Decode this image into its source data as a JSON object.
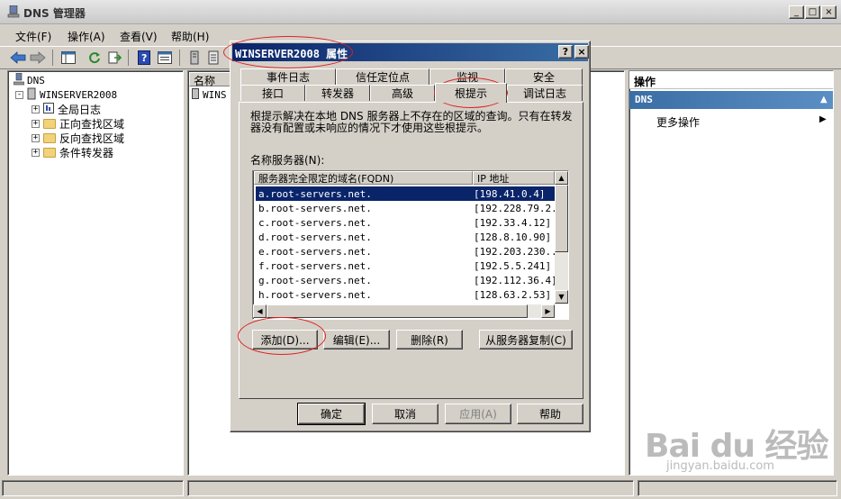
{
  "app": {
    "title": "DNS 管理器",
    "window_controls": [
      "_",
      "□",
      "×"
    ]
  },
  "menu": [
    "文件(F)",
    "操作(A)",
    "查看(V)",
    "帮助(H)"
  ],
  "tree": {
    "root": "DNS",
    "server": "WINSERVER2008",
    "children": [
      "全局日志",
      "正向查找区域",
      "反向查找区域",
      "条件转发器"
    ]
  },
  "list": {
    "column_name": "名称",
    "item": "WINS"
  },
  "actions": {
    "title": "操作",
    "section": "DNS",
    "more": "更多操作"
  },
  "dialog": {
    "title": "WINSERVER2008 属性",
    "help_btn": "?",
    "close_btn": "×",
    "tabs_row1": [
      "事件日志",
      "信任定位点",
      "监视",
      "安全"
    ],
    "tabs_row2": [
      "接口",
      "转发器",
      "高级",
      "根提示",
      "调试日志"
    ],
    "active_tab": "根提示",
    "description": "根提示解决在本地 DNS 服务器上不存在的区域的查询。只有在转发器没有配置或未响应的情况下才使用这些根提示。",
    "servers_label": "名称服务器(N):",
    "col_fqdn": "服务器完全限定的域名(FQDN)",
    "col_ip": "IP 地址",
    "rows": [
      {
        "fqdn": "a.root-servers.net.",
        "ip": "[198.41.0.4]"
      },
      {
        "fqdn": "b.root-servers.net.",
        "ip": "[192.228.79.2..."
      },
      {
        "fqdn": "c.root-servers.net.",
        "ip": "[192.33.4.12]"
      },
      {
        "fqdn": "d.root-servers.net.",
        "ip": "[128.8.10.90]"
      },
      {
        "fqdn": "e.root-servers.net.",
        "ip": "[192.203.230...."
      },
      {
        "fqdn": "f.root-servers.net.",
        "ip": "[192.5.5.241]"
      },
      {
        "fqdn": "g.root-servers.net.",
        "ip": "[192.112.36.4]"
      },
      {
        "fqdn": "h.root-servers.net.",
        "ip": "[128.63.2.53]"
      }
    ],
    "btn_add": "添加(D)...",
    "btn_edit": "编辑(E)...",
    "btn_remove": "删除(R)",
    "btn_copy": "从服务器复制(C)",
    "btn_ok": "确定",
    "btn_cancel": "取消",
    "btn_apply": "应用(A)",
    "btn_help": "帮助"
  },
  "watermark": {
    "brand": "Bai du 经验",
    "url": "jingyan.baidu.com"
  },
  "colors": {
    "selection": "#0a246a",
    "annotation": "#e02020",
    "action_header": "#3a6ea5"
  }
}
